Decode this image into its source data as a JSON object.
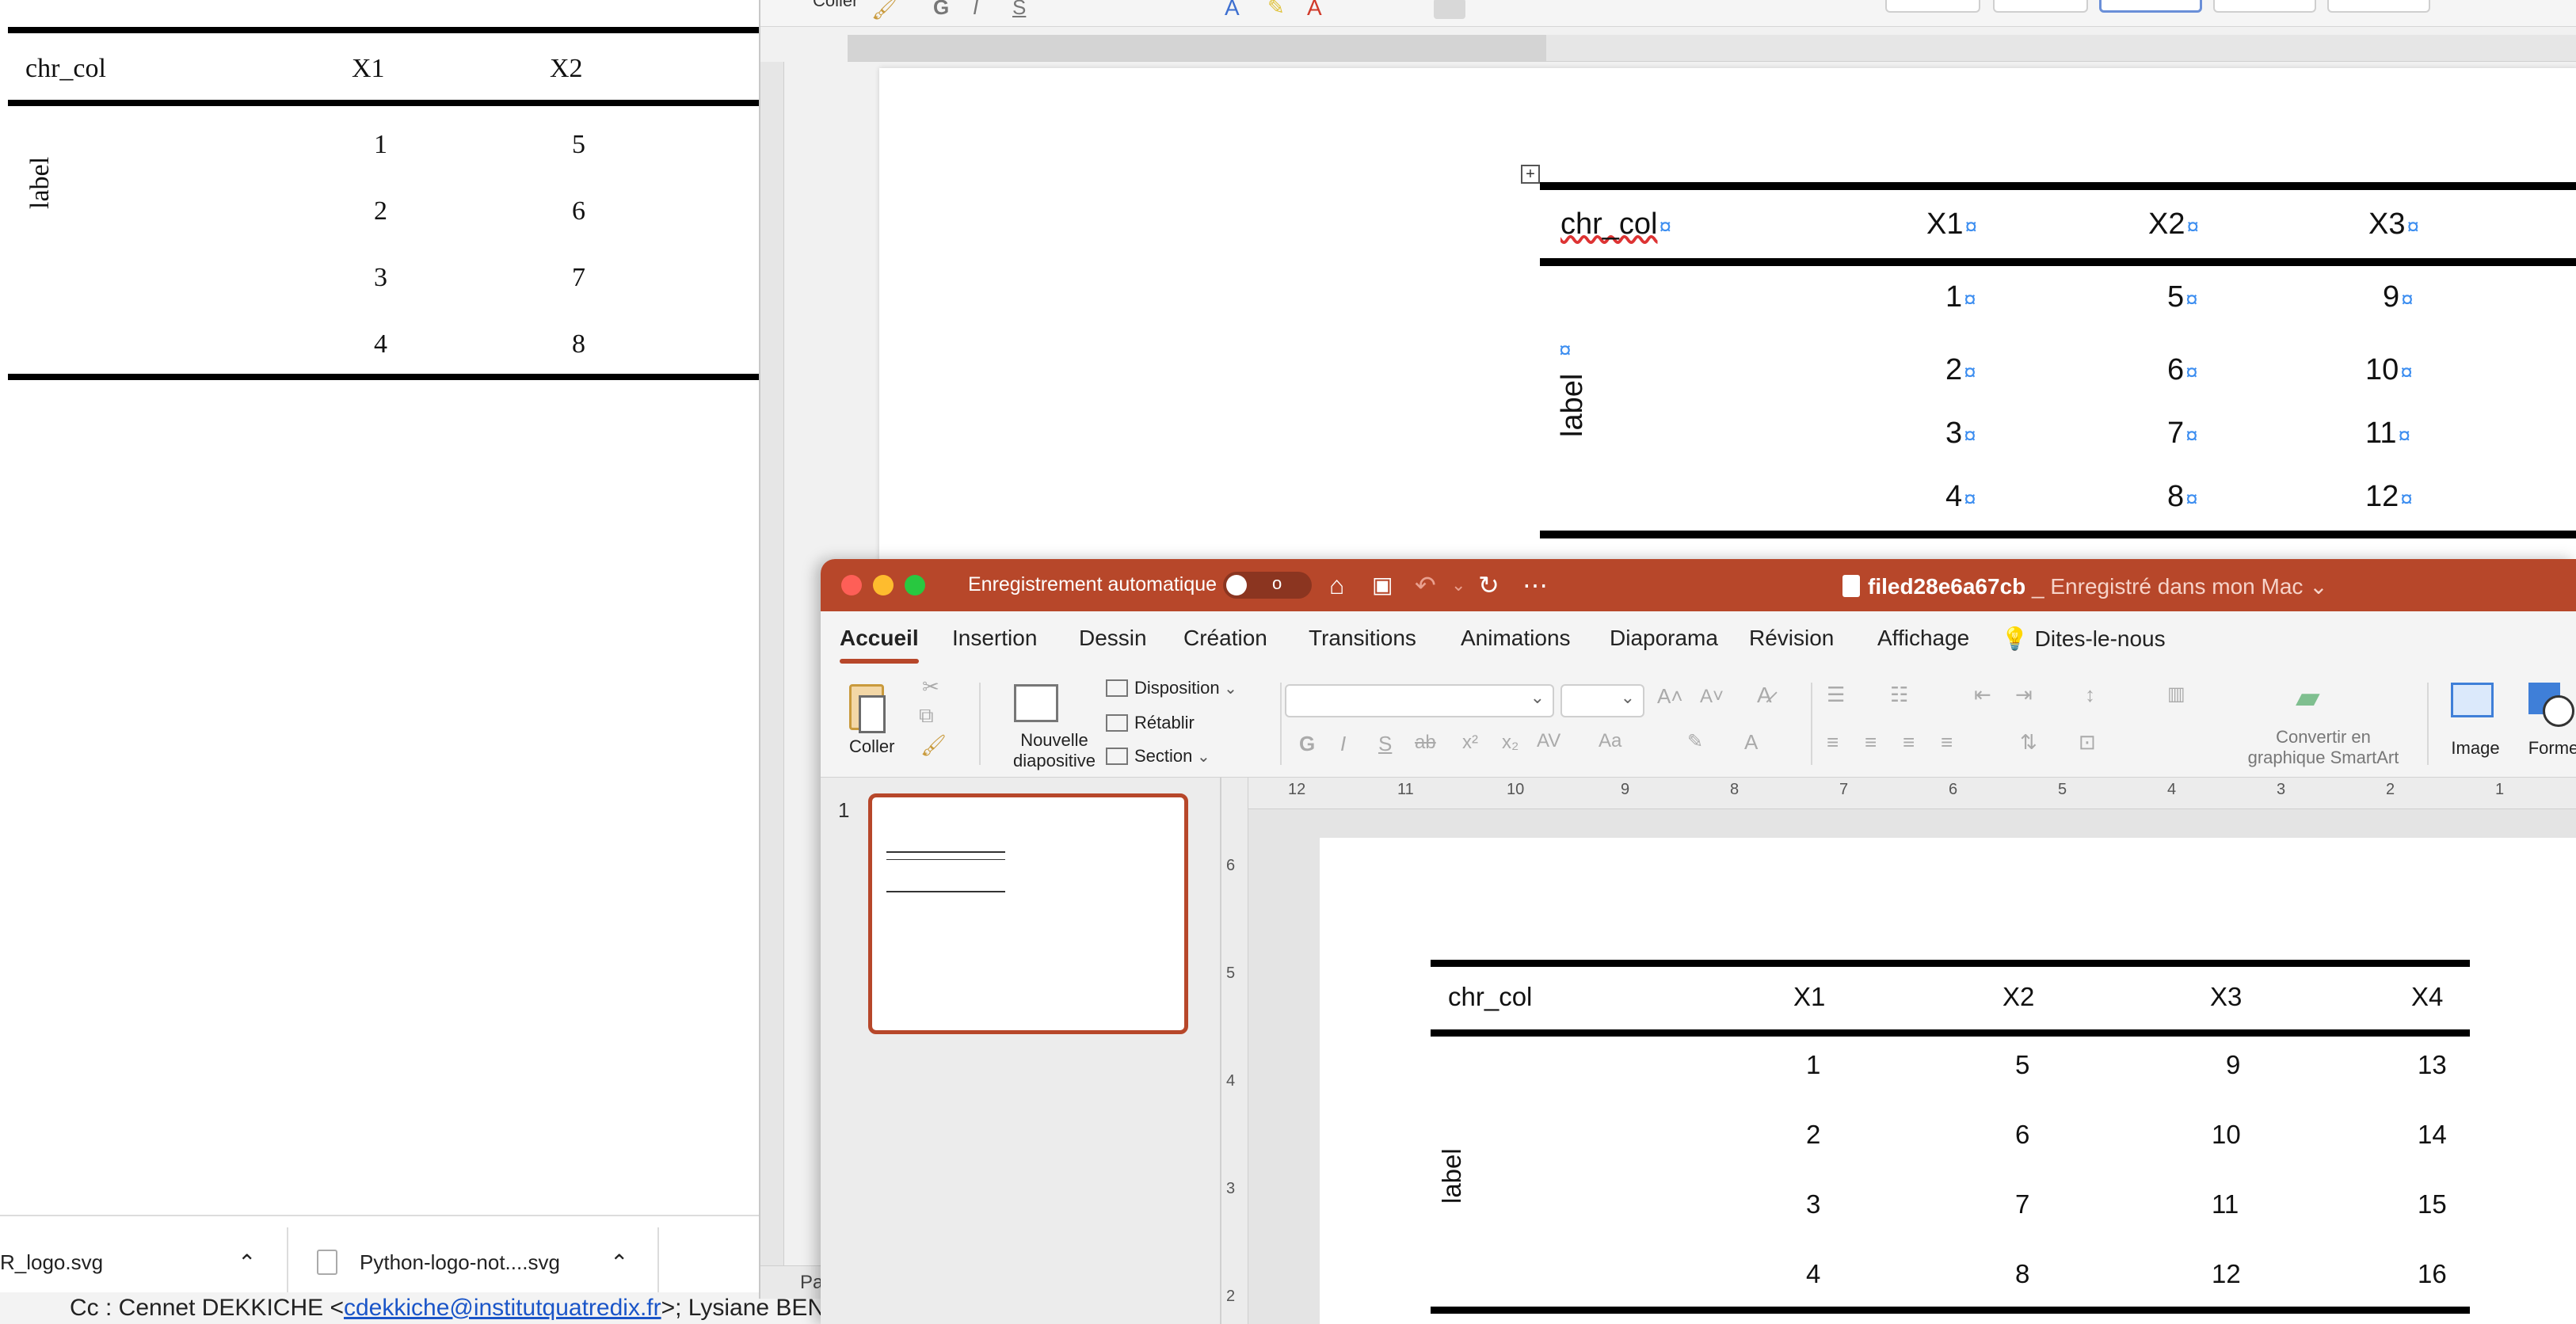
{
  "browser": {
    "table": {
      "headers": [
        "chr_col",
        "X1",
        "X2"
      ],
      "row_label": "label",
      "columns": [
        [
          "1",
          "2",
          "3",
          "4"
        ],
        [
          "5",
          "6",
          "7",
          "8"
        ]
      ]
    },
    "downloads": [
      {
        "name": "R_logo.svg"
      },
      {
        "name": "Python-logo-not....svg"
      }
    ],
    "mail_line": {
      "prefix": "Cc : Cennet DEKKICHE <",
      "address": "cdekkiche@institutquatredix.fr",
      "suffix": ">; Lysiane BEN"
    }
  },
  "word": {
    "ribbon_label": "Coller",
    "status_text": "Pa",
    "table": {
      "headers": [
        "chr_col",
        "X1",
        "X2",
        "X3"
      ],
      "row_label": "label",
      "columns": [
        [
          "1",
          "2",
          "3",
          "4"
        ],
        [
          "5",
          "6",
          "7",
          "8"
        ],
        [
          "9",
          "10",
          "11",
          "12"
        ]
      ]
    }
  },
  "ppt": {
    "autosave_label": "Enregistrement automatique",
    "autosave_state": "o",
    "file_name": "filed28e6a67cb",
    "file_status": "_ Enregistré dans mon Mac",
    "tabs": [
      "Accueil",
      "Insertion",
      "Dessin",
      "Création",
      "Transitions",
      "Animations",
      "Diaporama",
      "Révision",
      "Affichage",
      "Dites-le-nous"
    ],
    "ribbon": {
      "paste": "Coller",
      "new_slide": "Nouvelle\ndiapositive",
      "layout": "Disposition",
      "reset": "Rétablir",
      "section": "Section",
      "smartart": "Convertir en\ngraphique SmartArt",
      "image": "Image",
      "shapes": "Formes"
    },
    "slide_number": "1",
    "ruler_h": [
      "12",
      "11",
      "10",
      "9",
      "8",
      "7",
      "6",
      "5",
      "4",
      "3",
      "2",
      "1"
    ],
    "ruler_v": [
      "6",
      "5",
      "4",
      "3",
      "2"
    ],
    "table": {
      "headers": [
        "chr_col",
        "X1",
        "X2",
        "X3",
        "X4"
      ],
      "row_label": "label",
      "columns": [
        [
          "1",
          "2",
          "3",
          "4"
        ],
        [
          "5",
          "6",
          "7",
          "8"
        ],
        [
          "9",
          "10",
          "11",
          "12"
        ],
        [
          "13",
          "14",
          "15",
          "16"
        ]
      ]
    }
  },
  "colors": {
    "ppt_accent": "#b7472a",
    "pilcrow": "#3d8ef0",
    "link": "#1a55c8"
  }
}
